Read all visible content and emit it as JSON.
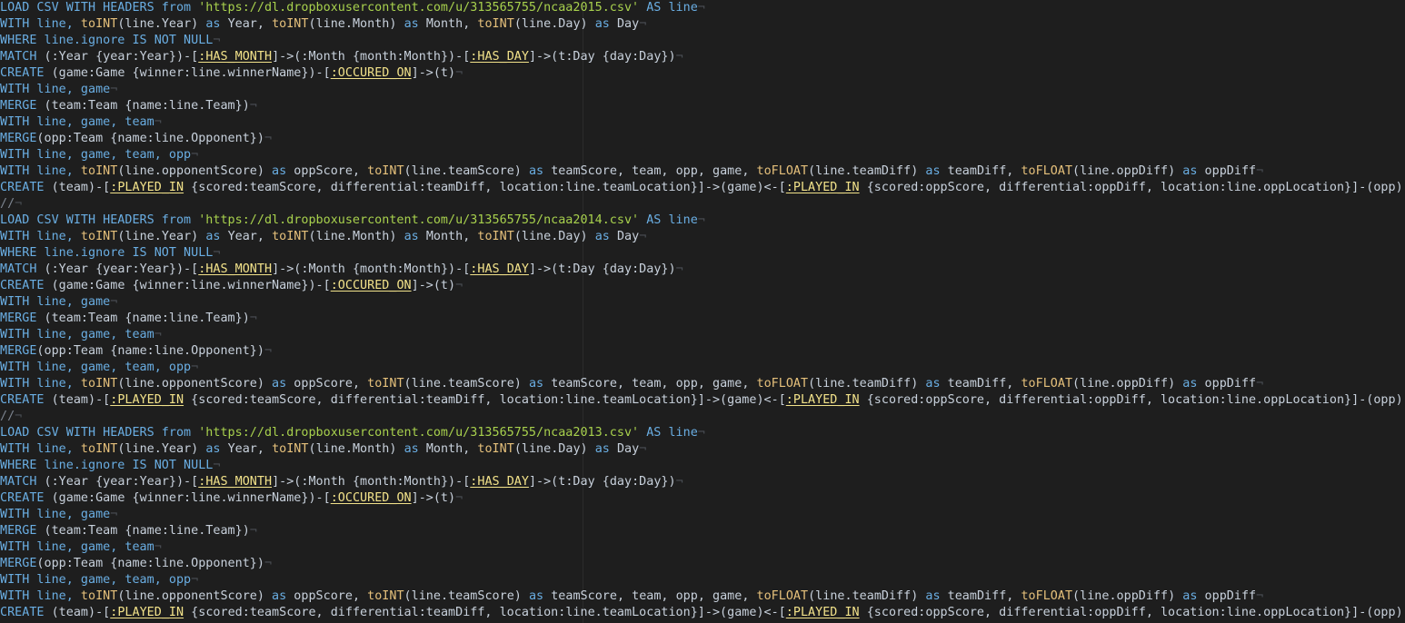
{
  "lines": [
    [
      [
        "kw",
        "LOAD CSV WITH HEADERS from "
      ],
      [
        "str",
        "'https://dl.dropboxusercontent.com/u/313565755/ncaa2015.csv'"
      ],
      [
        "kw",
        " AS line"
      ],
      [
        "eol",
        "¬"
      ]
    ],
    [
      [
        "kw",
        "WITH line, "
      ],
      [
        "fn",
        "toINT"
      ],
      [
        "prop",
        "(line.Year) "
      ],
      [
        "kw",
        "as"
      ],
      [
        "prop",
        " Year, "
      ],
      [
        "fn",
        "toINT"
      ],
      [
        "prop",
        "(line.Month) "
      ],
      [
        "kw",
        "as"
      ],
      [
        "prop",
        " Month, "
      ],
      [
        "fn",
        "toINT"
      ],
      [
        "prop",
        "(line.Day) "
      ],
      [
        "kw",
        "as"
      ],
      [
        "prop",
        " Day"
      ],
      [
        "eol",
        "¬"
      ]
    ],
    [
      [
        "kw",
        "WHERE line.ignore IS NOT NULL"
      ],
      [
        "eol",
        "¬"
      ]
    ],
    [
      [
        "kw",
        "MATCH"
      ],
      [
        "prop",
        " (:Year {year:Year})-["
      ],
      [
        "rel",
        ":HAS_MONTH"
      ],
      [
        "prop",
        "]->(:Month {month:Month})-["
      ],
      [
        "rel",
        ":HAS_DAY"
      ],
      [
        "prop",
        "]->(t:Day {day:Day})"
      ],
      [
        "eol",
        "¬"
      ]
    ],
    [
      [
        "kw",
        "CREATE"
      ],
      [
        "prop",
        " (game:Game {winner:line.winnerName})-["
      ],
      [
        "rel",
        ":OCCURED_ON"
      ],
      [
        "prop",
        "]->(t)"
      ],
      [
        "eol",
        "¬"
      ]
    ],
    [
      [
        "kw",
        "WITH line, game"
      ],
      [
        "eol",
        "¬"
      ]
    ],
    [
      [
        "kw",
        "MERGE"
      ],
      [
        "prop",
        " (team:Team {name:line.Team})"
      ],
      [
        "eol",
        "¬"
      ]
    ],
    [
      [
        "kw",
        "WITH line, game, team"
      ],
      [
        "eol",
        "¬"
      ]
    ],
    [
      [
        "kw",
        "MERGE"
      ],
      [
        "prop",
        "(opp:Team {name:line.Opponent})"
      ],
      [
        "eol",
        "¬"
      ]
    ],
    [
      [
        "kw",
        "WITH line, game, team, opp"
      ],
      [
        "eol",
        "¬"
      ]
    ],
    [
      [
        "kw",
        "WITH line, "
      ],
      [
        "fn",
        "toINT"
      ],
      [
        "prop",
        "(line.opponentScore) "
      ],
      [
        "kw",
        "as"
      ],
      [
        "prop",
        " oppScore, "
      ],
      [
        "fn",
        "toINT"
      ],
      [
        "prop",
        "(line.teamScore) "
      ],
      [
        "kw",
        "as"
      ],
      [
        "prop",
        " teamScore, team, opp, game, "
      ],
      [
        "fn",
        "toFLOAT"
      ],
      [
        "prop",
        "(line.teamDiff) "
      ],
      [
        "kw",
        "as"
      ],
      [
        "prop",
        " teamDiff, "
      ],
      [
        "fn",
        "toFLOAT"
      ],
      [
        "prop",
        "(line.oppDiff) "
      ],
      [
        "kw",
        "as"
      ],
      [
        "prop",
        " oppDiff"
      ],
      [
        "eol",
        "¬"
      ]
    ],
    [
      [
        "kw",
        "CREATE"
      ],
      [
        "prop",
        " (team)-["
      ],
      [
        "rel",
        ":PLAYED_IN"
      ],
      [
        "prop",
        " {scored:teamScore, differential:teamDiff, location:line.teamLocation}]->(game)<-["
      ],
      [
        "rel",
        ":PLAYED_IN"
      ],
      [
        "prop",
        " {scored:oppScore, differential:oppDiff, location:line.oppLocation}]-(opp);"
      ],
      [
        "eol",
        "¬"
      ]
    ],
    [
      [
        "cmt",
        "//"
      ],
      [
        "eol",
        "¬"
      ]
    ],
    [
      [
        "kw",
        "LOAD CSV WITH HEADERS from "
      ],
      [
        "str",
        "'https://dl.dropboxusercontent.com/u/313565755/ncaa2014.csv'"
      ],
      [
        "kw",
        " AS line"
      ],
      [
        "eol",
        "¬"
      ]
    ],
    [
      [
        "kw",
        "WITH line, "
      ],
      [
        "fn",
        "toINT"
      ],
      [
        "prop",
        "(line.Year) "
      ],
      [
        "kw",
        "as"
      ],
      [
        "prop",
        " Year, "
      ],
      [
        "fn",
        "toINT"
      ],
      [
        "prop",
        "(line.Month) "
      ],
      [
        "kw",
        "as"
      ],
      [
        "prop",
        " Month, "
      ],
      [
        "fn",
        "toINT"
      ],
      [
        "prop",
        "(line.Day) "
      ],
      [
        "kw",
        "as"
      ],
      [
        "prop",
        " Day"
      ],
      [
        "eol",
        "¬"
      ]
    ],
    [
      [
        "kw",
        "WHERE line.ignore IS NOT NULL"
      ],
      [
        "eol",
        "¬"
      ]
    ],
    [
      [
        "kw",
        "MATCH"
      ],
      [
        "prop",
        " (:Year {year:Year})-["
      ],
      [
        "rel",
        ":HAS_MONTH"
      ],
      [
        "prop",
        "]->(:Month {month:Month})-["
      ],
      [
        "rel",
        ":HAS_DAY"
      ],
      [
        "prop",
        "]->(t:Day {day:Day})"
      ],
      [
        "eol",
        "¬"
      ]
    ],
    [
      [
        "kw",
        "CREATE"
      ],
      [
        "prop",
        " (game:Game {winner:line.winnerName})-["
      ],
      [
        "rel",
        ":OCCURED_ON"
      ],
      [
        "prop",
        "]->(t)"
      ],
      [
        "eol",
        "¬"
      ]
    ],
    [
      [
        "kw",
        "WITH line, game"
      ],
      [
        "eol",
        "¬"
      ]
    ],
    [
      [
        "kw",
        "MERGE"
      ],
      [
        "prop",
        " (team:Team {name:line.Team})"
      ],
      [
        "eol",
        "¬"
      ]
    ],
    [
      [
        "kw",
        "WITH line, game, team"
      ],
      [
        "eol",
        "¬"
      ]
    ],
    [
      [
        "kw",
        "MERGE"
      ],
      [
        "prop",
        "(opp:Team {name:line.Opponent})"
      ],
      [
        "eol",
        "¬"
      ]
    ],
    [
      [
        "kw",
        "WITH line, game, team, opp"
      ],
      [
        "eol",
        "¬"
      ]
    ],
    [
      [
        "kw",
        "WITH line, "
      ],
      [
        "fn",
        "toINT"
      ],
      [
        "prop",
        "(line.opponentScore) "
      ],
      [
        "kw",
        "as"
      ],
      [
        "prop",
        " oppScore, "
      ],
      [
        "fn",
        "toINT"
      ],
      [
        "prop",
        "(line.teamScore) "
      ],
      [
        "kw",
        "as"
      ],
      [
        "prop",
        " teamScore, team, opp, game, "
      ],
      [
        "fn",
        "toFLOAT"
      ],
      [
        "prop",
        "(line.teamDiff) "
      ],
      [
        "kw",
        "as"
      ],
      [
        "prop",
        " teamDiff, "
      ],
      [
        "fn",
        "toFLOAT"
      ],
      [
        "prop",
        "(line.oppDiff) "
      ],
      [
        "kw",
        "as"
      ],
      [
        "prop",
        " oppDiff"
      ],
      [
        "eol",
        "¬"
      ]
    ],
    [
      [
        "kw",
        "CREATE"
      ],
      [
        "prop",
        " (team)-["
      ],
      [
        "rel",
        ":PLAYED_IN"
      ],
      [
        "prop",
        " {scored:teamScore, differential:teamDiff, location:line.teamLocation}]->(game)<-["
      ],
      [
        "rel",
        ":PLAYED_IN"
      ],
      [
        "prop",
        " {scored:oppScore, differential:oppDiff, location:line.oppLocation}]-(opp);"
      ],
      [
        "eol",
        "¬"
      ]
    ],
    [
      [
        "cmt",
        "//"
      ],
      [
        "eol",
        "¬"
      ]
    ],
    [
      [
        "kw",
        "LOAD CSV WITH HEADERS from "
      ],
      [
        "str",
        "'https://dl.dropboxusercontent.com/u/313565755/ncaa2013.csv'"
      ],
      [
        "kw",
        " AS line"
      ],
      [
        "eol",
        "¬"
      ]
    ],
    [
      [
        "kw",
        "WITH line, "
      ],
      [
        "fn",
        "toINT"
      ],
      [
        "prop",
        "(line.Year) "
      ],
      [
        "kw",
        "as"
      ],
      [
        "prop",
        " Year, "
      ],
      [
        "fn",
        "toINT"
      ],
      [
        "prop",
        "(line.Month) "
      ],
      [
        "kw",
        "as"
      ],
      [
        "prop",
        " Month, "
      ],
      [
        "fn",
        "toINT"
      ],
      [
        "prop",
        "(line.Day) "
      ],
      [
        "kw",
        "as"
      ],
      [
        "prop",
        " Day"
      ],
      [
        "eol",
        "¬"
      ]
    ],
    [
      [
        "kw",
        "WHERE line.ignore IS NOT NULL"
      ],
      [
        "eol",
        "¬"
      ]
    ],
    [
      [
        "kw",
        "MATCH"
      ],
      [
        "prop",
        " (:Year {year:Year})-["
      ],
      [
        "rel",
        ":HAS_MONTH"
      ],
      [
        "prop",
        "]->(:Month {month:Month})-["
      ],
      [
        "rel",
        ":HAS_DAY"
      ],
      [
        "prop",
        "]->(t:Day {day:Day})"
      ],
      [
        "eol",
        "¬"
      ]
    ],
    [
      [
        "kw",
        "CREATE"
      ],
      [
        "prop",
        " (game:Game {winner:line.winnerName})-["
      ],
      [
        "rel",
        ":OCCURED_ON"
      ],
      [
        "prop",
        "]->(t)"
      ],
      [
        "eol",
        "¬"
      ]
    ],
    [
      [
        "kw",
        "WITH line, game"
      ],
      [
        "eol",
        "¬"
      ]
    ],
    [
      [
        "kw",
        "MERGE"
      ],
      [
        "prop",
        " (team:Team {name:line.Team})"
      ],
      [
        "eol",
        "¬"
      ]
    ],
    [
      [
        "kw",
        "WITH line, game, team"
      ],
      [
        "eol",
        "¬"
      ]
    ],
    [
      [
        "kw",
        "MERGE"
      ],
      [
        "prop",
        "(opp:Team {name:line.Opponent})"
      ],
      [
        "eol",
        "¬"
      ]
    ],
    [
      [
        "kw",
        "WITH line, game, team, opp"
      ],
      [
        "eol",
        "¬"
      ]
    ],
    [
      [
        "kw",
        "WITH line, "
      ],
      [
        "fn",
        "toINT"
      ],
      [
        "prop",
        "(line.opponentScore) "
      ],
      [
        "kw",
        "as"
      ],
      [
        "prop",
        " oppScore, "
      ],
      [
        "fn",
        "toINT"
      ],
      [
        "prop",
        "(line.teamScore) "
      ],
      [
        "kw",
        "as"
      ],
      [
        "prop",
        " teamScore, team, opp, game, "
      ],
      [
        "fn",
        "toFLOAT"
      ],
      [
        "prop",
        "(line.teamDiff) "
      ],
      [
        "kw",
        "as"
      ],
      [
        "prop",
        " teamDiff, "
      ],
      [
        "fn",
        "toFLOAT"
      ],
      [
        "prop",
        "(line.oppDiff) "
      ],
      [
        "kw",
        "as"
      ],
      [
        "prop",
        " oppDiff"
      ],
      [
        "eol",
        "¬"
      ]
    ],
    [
      [
        "kw",
        "CREATE"
      ],
      [
        "prop",
        " (team)-["
      ],
      [
        "rel",
        ":PLAYED_IN"
      ],
      [
        "prop",
        " {scored:teamScore, differential:teamDiff, location:line.teamLocation}]->(game)<-["
      ],
      [
        "rel",
        ":PLAYED_IN"
      ],
      [
        "prop",
        " {scored:oppScore, differential:oppDiff, location:line.oppLocation}]-(opp);"
      ],
      [
        "eol",
        "¬"
      ]
    ]
  ]
}
